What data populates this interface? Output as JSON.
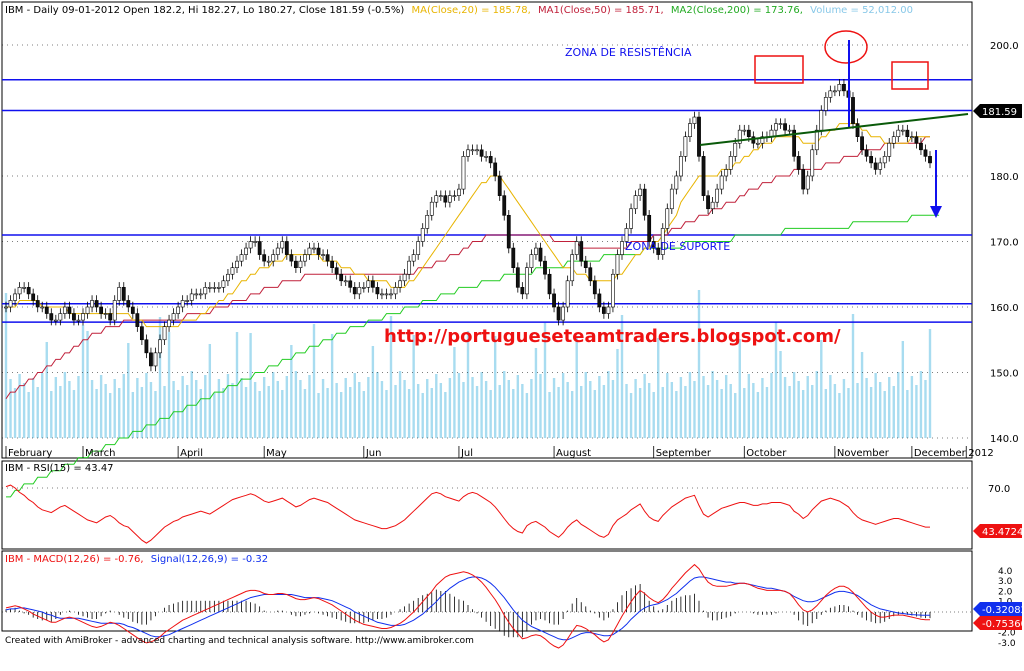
{
  "header": {
    "symbol": "IBM",
    "info": "IBM - Daily 09-01-2012 Open 182.2, Hi 182.27, Lo 180.27, Close 181.59 (-0.5%)",
    "ma20": "MA(Close,20) = 185.78,",
    "ma50": "MA1(Close,50) = 185.71,",
    "ma200": "MA2(Close,200) = 173.76,",
    "volume": "Volume = 52,012.00"
  },
  "annotations": {
    "resistance": "ZONA DE RESISTÊNCIA",
    "support": "ZONA DE SUPORTE",
    "url": "http://portugueseteamtraders.blogspot.com/",
    "last_price": "181.59"
  },
  "rsi_panel": {
    "title": "IBM - RSI(15) = 43.47",
    "last_label": "43.4724",
    "level_label": "70.0"
  },
  "macd_panel": {
    "title_a": "IBM - MACD(12,26) = -0.76,",
    "title_b": "Signal(12,26,9) = -0.32",
    "signal_label": "-0.32082",
    "macd_label": "-0.75360",
    "ticks": [
      "4.0",
      "3.0",
      "2.0",
      "1.0",
      "-1.0",
      "-2.0",
      "-3.0"
    ]
  },
  "footer": "Created with AmiBroker - advanced charting and technical analysis software. http://www.amibroker.com",
  "colors": {
    "ma20": "#e8b400",
    "ma50": "#c0203a",
    "ma200": "#22cc22",
    "hline": "#1010ee",
    "volume": "#a8dcf0",
    "rsi": "#ee1111",
    "macd": "#ee1111",
    "signal": "#1030ee",
    "candle_up": "#ffffff",
    "candle_down": "#111111"
  },
  "chart_data": {
    "type": "candlestick",
    "x_ticks": [
      "February",
      "March",
      "April",
      "May",
      "Jun",
      "Jul",
      "August",
      "September",
      "October",
      "November",
      "December",
      "2012"
    ],
    "y_ticks": [
      140.0,
      150.0,
      160.0,
      170.0,
      180.0,
      190.0,
      200.0
    ],
    "ylim": [
      130,
      200
    ],
    "horizontal_levels": [
      194.7,
      190.0,
      171.0,
      160.5,
      157.7
    ],
    "close": [
      160,
      161,
      162,
      163,
      163,
      162,
      161,
      160,
      160,
      159,
      158,
      158,
      159,
      160,
      159,
      158,
      158,
      159,
      160,
      161,
      160,
      159,
      159,
      158,
      161,
      163,
      161,
      160,
      159,
      157,
      155,
      153,
      151,
      153,
      155,
      157,
      158,
      159,
      160,
      161,
      161,
      162,
      162,
      162,
      163,
      163,
      163,
      163,
      164,
      165,
      166,
      167,
      168,
      169,
      170,
      170,
      168,
      167,
      167,
      168,
      169,
      170,
      168,
      167,
      166,
      167,
      168,
      169,
      169,
      168,
      168,
      167,
      166,
      165,
      164,
      164,
      163,
      162,
      163,
      163,
      164,
      163,
      162,
      162,
      162,
      162,
      163,
      164,
      165,
      167,
      168,
      170,
      172,
      174,
      176,
      177,
      177,
      176,
      177,
      177,
      178,
      183,
      184,
      184,
      184,
      183,
      183,
      182,
      180,
      177,
      174,
      169,
      166,
      163,
      162,
      166,
      168,
      169,
      167,
      165,
      162,
      160,
      158,
      160,
      164,
      168,
      170,
      167,
      166,
      164,
      162,
      160,
      159,
      160,
      165,
      168,
      170,
      172,
      175,
      177,
      178,
      174,
      170,
      169,
      168,
      172,
      175,
      178,
      180,
      183,
      186,
      188,
      189,
      183,
      177,
      175,
      176,
      178,
      180,
      181,
      183,
      185,
      187,
      187,
      186,
      185,
      185,
      186,
      186,
      187,
      188,
      188,
      187,
      187,
      183,
      181,
      178,
      180,
      184,
      187,
      190,
      192,
      193,
      193,
      194,
      193,
      192,
      188,
      186,
      184,
      183,
      182,
      181,
      182,
      183,
      185,
      186,
      187,
      187,
      186,
      186,
      185,
      184,
      183,
      182
    ],
    "ma20": [
      160,
      160,
      160,
      161,
      161,
      161,
      161,
      161,
      160,
      160,
      160,
      160,
      160,
      160,
      159,
      159,
      159,
      159,
      159,
      159,
      159,
      159,
      159,
      159,
      159,
      159,
      159,
      159,
      158,
      158,
      158,
      157,
      157,
      157,
      157,
      157,
      157,
      157,
      157,
      158,
      158,
      158,
      158,
      159,
      159,
      160,
      160,
      161,
      161,
      162,
      162,
      163,
      164,
      164,
      165,
      165,
      166,
      166,
      166,
      167,
      167,
      167,
      168,
      168,
      168,
      168,
      168,
      168,
      168,
      168,
      167,
      167,
      167,
      167,
      166,
      166,
      166,
      165,
      165,
      165,
      164,
      164,
      164,
      164,
      164,
      163,
      163,
      163,
      163,
      164,
      164,
      165,
      166,
      167,
      168,
      169,
      170,
      171,
      172,
      173,
      174,
      175,
      176,
      177,
      178,
      179,
      179,
      180,
      180,
      180,
      179,
      178,
      177,
      176,
      175,
      174,
      173,
      172,
      171,
      170,
      169,
      168,
      167,
      166,
      166,
      166,
      165,
      165,
      165,
      164,
      164,
      164,
      164,
      164,
      164,
      165,
      165,
      166,
      167,
      168,
      168,
      169,
      169,
      170,
      170,
      171,
      172,
      173,
      174,
      176,
      177,
      178,
      179,
      180,
      180,
      180,
      180,
      180,
      181,
      181,
      181,
      182,
      182,
      183,
      183,
      184,
      184,
      185,
      185,
      185,
      186,
      186,
      186,
      186,
      186,
      186,
      185,
      185,
      185,
      185,
      186,
      186,
      187,
      187,
      188,
      188,
      188,
      188,
      188,
      187,
      187,
      186,
      186,
      186,
      185,
      185,
      185,
      185,
      185,
      185,
      186,
      186,
      186,
      186,
      186
    ],
    "ma50": [
      146,
      147,
      147,
      148,
      148,
      149,
      149,
      150,
      150,
      151,
      151,
      152,
      152,
      153,
      153,
      154,
      154,
      155,
      155,
      156,
      156,
      156,
      157,
      157,
      157,
      157,
      158,
      158,
      158,
      158,
      158,
      158,
      158,
      158,
      158,
      158,
      158,
      158,
      158,
      158,
      159,
      159,
      159,
      159,
      159,
      159,
      160,
      160,
      160,
      160,
      161,
      161,
      161,
      161,
      162,
      162,
      162,
      163,
      163,
      163,
      163,
      164,
      164,
      164,
      164,
      164,
      165,
      165,
      165,
      165,
      165,
      165,
      165,
      165,
      165,
      165,
      165,
      165,
      165,
      165,
      165,
      165,
      165,
      165,
      165,
      165,
      165,
      165,
      165,
      165,
      165,
      166,
      166,
      166,
      166,
      167,
      167,
      167,
      168,
      168,
      168,
      169,
      169,
      170,
      170,
      170,
      171,
      171,
      171,
      171,
      171,
      171,
      171,
      171,
      171,
      171,
      171,
      171,
      171,
      171,
      171,
      170,
      170,
      170,
      170,
      170,
      170,
      169,
      169,
      169,
      169,
      169,
      169,
      169,
      169,
      169,
      169,
      169,
      170,
      170,
      170,
      170,
      170,
      171,
      171,
      171,
      171,
      172,
      172,
      172,
      173,
      173,
      173,
      174,
      174,
      174,
      175,
      175,
      175,
      176,
      176,
      176,
      177,
      177,
      178,
      178,
      178,
      179,
      179,
      179,
      180,
      180,
      180,
      180,
      181,
      181,
      181,
      181,
      181,
      181,
      181,
      182,
      182,
      182,
      182,
      183,
      183,
      183,
      183,
      184,
      184,
      184,
      184,
      184,
      185,
      185,
      185,
      185,
      185,
      185,
      185,
      185,
      185,
      186,
      186
    ],
    "ma200": [
      131,
      131,
      132,
      132,
      133,
      133,
      133,
      134,
      134,
      134,
      135,
      135,
      135,
      136,
      136,
      136,
      137,
      137,
      137,
      138,
      138,
      138,
      139,
      139,
      139,
      140,
      140,
      140,
      141,
      141,
      141,
      142,
      142,
      142,
      143,
      143,
      143,
      144,
      144,
      144,
      145,
      145,
      145,
      146,
      146,
      146,
      147,
      147,
      147,
      148,
      148,
      148,
      149,
      149,
      149,
      150,
      150,
      150,
      151,
      151,
      151,
      152,
      152,
      152,
      153,
      153,
      153,
      154,
      154,
      154,
      155,
      155,
      155,
      156,
      156,
      156,
      157,
      157,
      157,
      157,
      158,
      158,
      158,
      158,
      159,
      159,
      159,
      159,
      160,
      160,
      160,
      160,
      161,
      161,
      161,
      161,
      162,
      162,
      162,
      162,
      163,
      163,
      163,
      163,
      163,
      164,
      164,
      164,
      164,
      164,
      165,
      165,
      165,
      165,
      165,
      165,
      165,
      166,
      166,
      166,
      166,
      166,
      166,
      166,
      167,
      167,
      167,
      167,
      167,
      167,
      167,
      167,
      168,
      168,
      168,
      168,
      168,
      168,
      168,
      168,
      168,
      169,
      169,
      169,
      169,
      169,
      169,
      169,
      169,
      169,
      170,
      170,
      170,
      170,
      170,
      170,
      170,
      170,
      170,
      170,
      170,
      171,
      171,
      171,
      171,
      171,
      171,
      171,
      171,
      171,
      171,
      171,
      172,
      172,
      172,
      172,
      172,
      172,
      172,
      172,
      172,
      172,
      172,
      172,
      172,
      172,
      172,
      173,
      173,
      173,
      173,
      173,
      173,
      173,
      173,
      173,
      173,
      173,
      173,
      173,
      174,
      174,
      174,
      174,
      174,
      174,
      174
    ],
    "rsi": [
      71,
      72,
      70,
      67,
      65,
      62,
      60,
      57,
      55,
      54,
      53,
      55,
      57,
      58,
      56,
      54,
      52,
      50,
      48,
      47,
      46,
      48,
      50,
      51,
      49,
      46,
      44,
      43,
      40,
      37,
      34,
      32,
      34,
      37,
      40,
      43,
      45,
      47,
      48,
      50,
      51,
      52,
      53,
      54,
      53,
      52,
      54,
      56,
      58,
      60,
      62,
      63,
      64,
      65,
      66,
      65,
      63,
      61,
      60,
      61,
      62,
      63,
      61,
      59,
      57,
      58,
      60,
      62,
      63,
      62,
      61,
      60,
      58,
      56,
      54,
      52,
      50,
      48,
      47,
      46,
      45,
      44,
      43,
      42,
      42,
      43,
      44,
      46,
      48,
      51,
      54,
      57,
      60,
      63,
      66,
      67,
      66,
      64,
      63,
      62,
      61,
      64,
      66,
      67,
      66,
      64,
      62,
      60,
      57,
      53,
      49,
      45,
      42,
      40,
      39,
      44,
      46,
      47,
      45,
      43,
      40,
      38,
      36,
      39,
      43,
      46,
      48,
      45,
      43,
      41,
      39,
      37,
      36,
      38,
      44,
      48,
      50,
      52,
      55,
      57,
      59,
      54,
      50,
      48,
      47,
      51,
      54,
      57,
      59,
      61,
      63,
      64,
      65,
      58,
      52,
      50,
      52,
      54,
      56,
      57,
      58,
      59,
      60,
      60,
      59,
      58,
      58,
      59,
      59,
      60,
      60,
      60,
      59,
      58,
      54,
      52,
      49,
      51,
      55,
      58,
      61,
      62,
      63,
      62,
      61,
      59,
      57,
      53,
      50,
      48,
      47,
      46,
      45,
      46,
      47,
      48,
      49,
      49,
      48,
      47,
      46,
      45,
      44,
      43,
      43
    ],
    "macd": [
      0.4,
      0.5,
      0.6,
      0.5,
      0.3,
      0.1,
      -0.2,
      -0.4,
      -0.6,
      -0.8,
      -1.0,
      -1.0,
      -0.8,
      -0.6,
      -0.5,
      -0.6,
      -0.8,
      -1.0,
      -1.2,
      -1.4,
      -1.5,
      -1.4,
      -1.2,
      -1.0,
      -1.1,
      -1.3,
      -1.6,
      -1.9,
      -2.2,
      -2.5,
      -2.8,
      -3.0,
      -2.9,
      -2.7,
      -2.4,
      -2.0,
      -1.7,
      -1.4,
      -1.1,
      -0.8,
      -0.6,
      -0.4,
      -0.2,
      0.0,
      0.2,
      0.4,
      0.6,
      0.8,
      1.0,
      1.2,
      1.4,
      1.6,
      1.8,
      2.0,
      2.1,
      2.1,
      2.0,
      1.8,
      1.7,
      1.7,
      1.8,
      1.8,
      1.7,
      1.5,
      1.3,
      1.2,
      1.2,
      1.3,
      1.4,
      1.3,
      1.1,
      0.9,
      0.7,
      0.4,
      0.1,
      -0.2,
      -0.5,
      -0.8,
      -1.0,
      -1.2,
      -1.3,
      -1.4,
      -1.5,
      -1.6,
      -1.6,
      -1.5,
      -1.3,
      -1.1,
      -0.8,
      -0.4,
      0.0,
      0.5,
      1.0,
      1.5,
      2.0,
      2.6,
      3.0,
      3.4,
      3.6,
      3.7,
      3.8,
      3.9,
      3.8,
      3.6,
      3.3,
      2.9,
      2.4,
      1.8,
      1.2,
      0.5,
      -0.3,
      -1.0,
      -1.6,
      -2.1,
      -2.6,
      -2.5,
      -2.3,
      -2.2,
      -2.3,
      -2.6,
      -3.0,
      -3.3,
      -3.5,
      -3.2,
      -2.6,
      -1.9,
      -1.3,
      -1.4,
      -1.6,
      -1.9,
      -2.2,
      -2.6,
      -2.9,
      -2.7,
      -2.0,
      -1.2,
      -0.4,
      0.3,
      1.0,
      1.6,
      2.1,
      1.8,
      1.4,
      1.1,
      0.9,
      1.2,
      1.7,
      2.3,
      2.8,
      3.3,
      3.8,
      4.2,
      4.6,
      4.2,
      3.5,
      2.9,
      2.6,
      2.5,
      2.5,
      2.5,
      2.6,
      2.7,
      2.8,
      2.8,
      2.7,
      2.5,
      2.3,
      2.2,
      2.1,
      2.1,
      2.1,
      2.1,
      2.0,
      1.8,
      1.3,
      0.7,
      0.2,
      0.0,
      0.2,
      0.6,
      1.1,
      1.6,
      2.0,
      2.3,
      2.5,
      2.5,
      2.3,
      1.9,
      1.4,
      0.9,
      0.4,
      0.0,
      -0.3,
      -0.5,
      -0.5,
      -0.4,
      -0.3,
      -0.3,
      -0.3,
      -0.4,
      -0.5,
      -0.6,
      -0.7,
      -0.75,
      -0.76
    ],
    "signal": [
      0.2,
      0.3,
      0.3,
      0.4,
      0.4,
      0.3,
      0.2,
      0.1,
      0.0,
      -0.2,
      -0.3,
      -0.5,
      -0.6,
      -0.6,
      -0.6,
      -0.6,
      -0.6,
      -0.7,
      -0.8,
      -0.9,
      -1.0,
      -1.1,
      -1.1,
      -1.1,
      -1.1,
      -1.1,
      -1.2,
      -1.4,
      -1.5,
      -1.7,
      -1.9,
      -2.1,
      -2.3,
      -2.4,
      -2.4,
      -2.3,
      -2.2,
      -2.0,
      -1.8,
      -1.6,
      -1.4,
      -1.2,
      -1.0,
      -0.8,
      -0.6,
      -0.4,
      -0.2,
      0.0,
      0.2,
      0.4,
      0.6,
      0.8,
      1.0,
      1.2,
      1.4,
      1.5,
      1.6,
      1.7,
      1.7,
      1.7,
      1.7,
      1.7,
      1.7,
      1.7,
      1.6,
      1.5,
      1.4,
      1.4,
      1.4,
      1.4,
      1.3,
      1.2,
      1.1,
      0.9,
      0.7,
      0.5,
      0.3,
      0.0,
      -0.2,
      -0.4,
      -0.6,
      -0.8,
      -1.0,
      -1.1,
      -1.2,
      -1.3,
      -1.3,
      -1.3,
      -1.2,
      -1.0,
      -0.8,
      -0.5,
      -0.2,
      0.2,
      0.6,
      1.0,
      1.5,
      1.9,
      2.3,
      2.6,
      2.9,
      3.1,
      3.3,
      3.4,
      3.4,
      3.3,
      3.1,
      2.8,
      2.4,
      1.9,
      1.4,
      0.8,
      0.2,
      -0.3,
      -0.8,
      -1.1,
      -1.4,
      -1.6,
      -1.8,
      -2.0,
      -2.2,
      -2.4,
      -2.6,
      -2.7,
      -2.7,
      -2.5,
      -2.3,
      -2.1,
      -2.0,
      -2.0,
      -2.1,
      -2.2,
      -2.3,
      -2.3,
      -2.2,
      -1.9,
      -1.6,
      -1.2,
      -0.7,
      -0.3,
      0.1,
      0.4,
      0.6,
      0.7,
      0.8,
      1.0,
      1.2,
      1.5,
      1.8,
      2.2,
      2.6,
      3.0,
      3.3,
      3.4,
      3.4,
      3.3,
      3.2,
      3.1,
      3.0,
      2.9,
      2.9,
      2.8,
      2.8,
      2.8,
      2.7,
      2.6,
      2.5,
      2.4,
      2.3,
      2.3,
      2.2,
      2.1,
      2.0,
      1.8,
      1.5,
      1.3,
      1.1,
      1.0,
      1.0,
      1.1,
      1.3,
      1.5,
      1.7,
      1.9,
      2.0,
      2.0,
      1.9,
      1.8,
      1.6,
      1.3,
      1.0,
      0.7,
      0.5,
      0.3,
      0.2,
      0.1,
      0.0,
      -0.1,
      -0.15,
      -0.2,
      -0.25,
      -0.28,
      -0.3,
      -0.31,
      -0.32
    ]
  }
}
